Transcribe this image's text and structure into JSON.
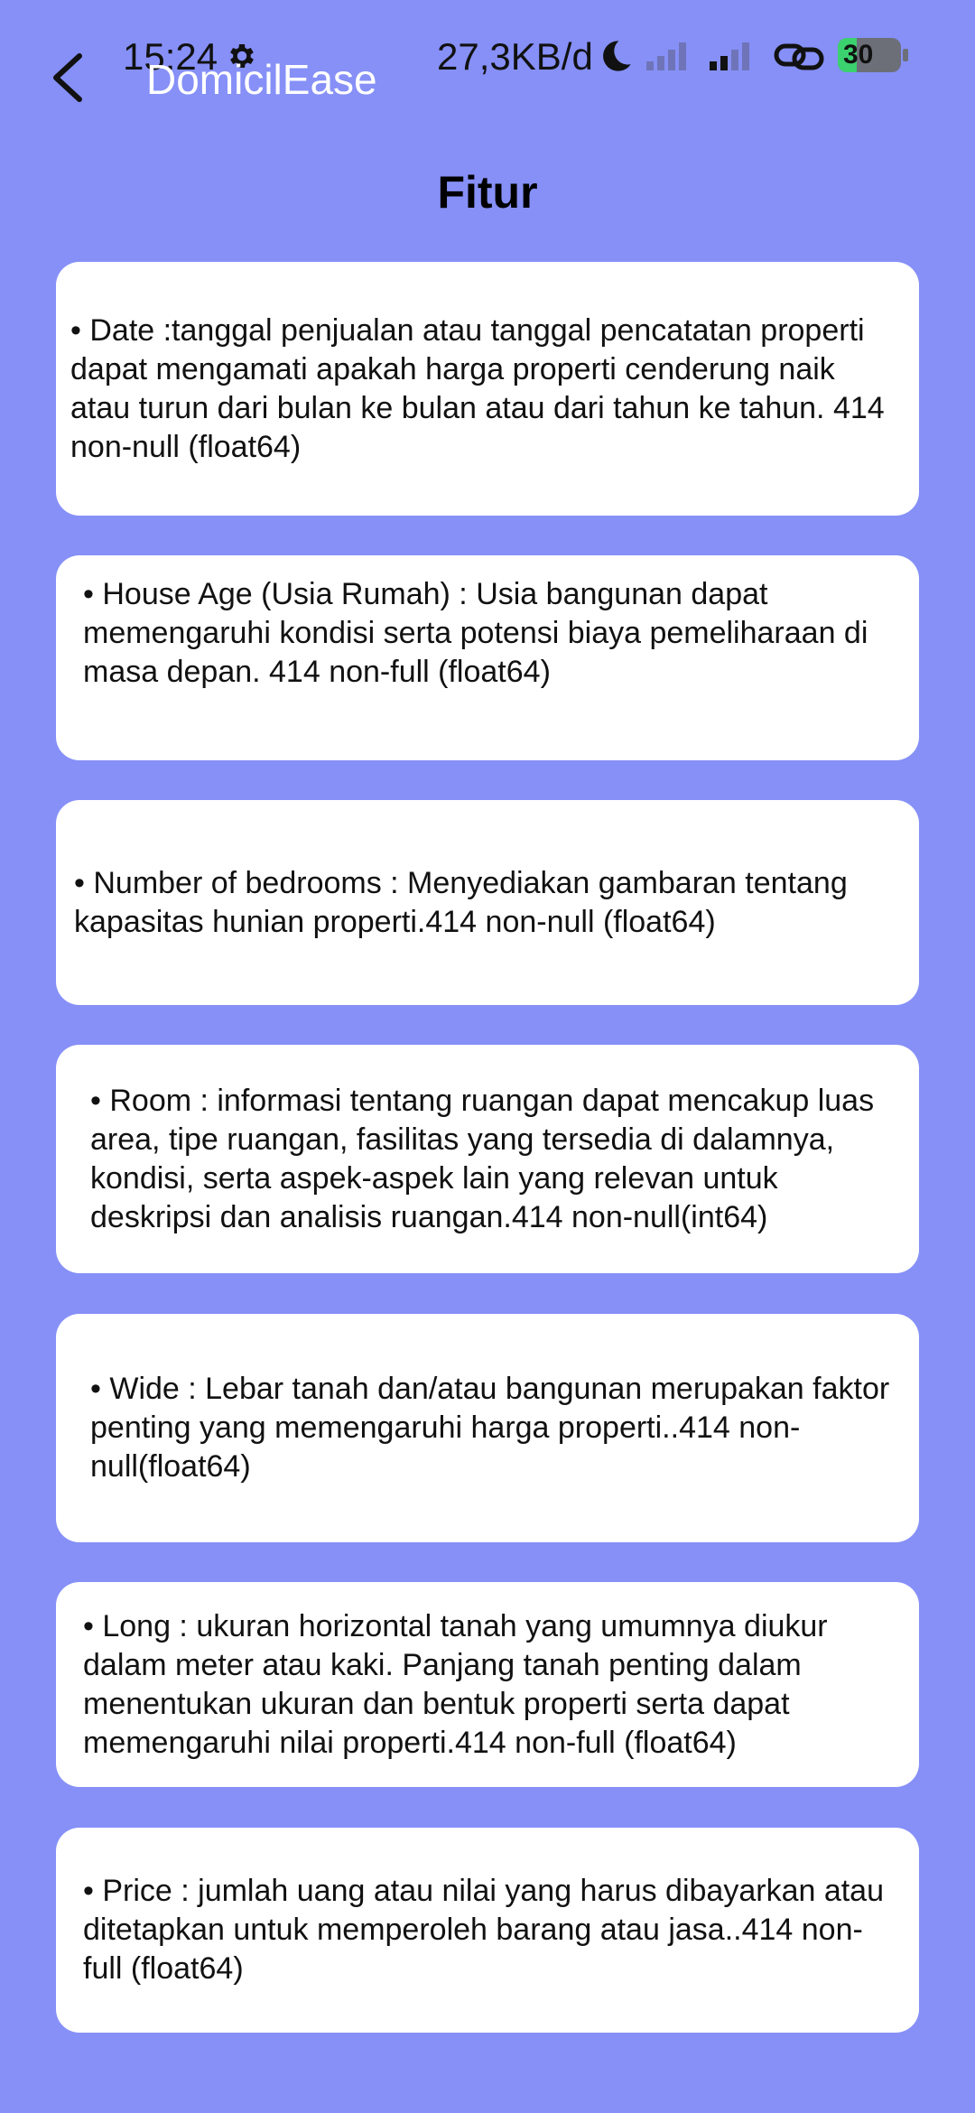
{
  "status_bar": {
    "time": "15:24",
    "network_speed": "27,3KB/d",
    "battery_level": "30",
    "battery_fraction": 0.3,
    "icons": [
      "gear-icon",
      "moon-icon",
      "signal-icon",
      "signal-icon",
      "link-icon",
      "battery-icon"
    ]
  },
  "app_bar": {
    "title": "DomicilEase",
    "back_icon": "back-arrow-icon"
  },
  "page": {
    "title": "Fitur"
  },
  "features": [
    {
      "text": "• Date :tanggal penjualan atau tanggal pencatatan properti dapat mengamati apakah harga properti cenderung naik atau turun dari bulan ke bulan atau dari tahun ke tahun. 414 non-null (float64)"
    },
    {
      "text": "• House Age (Usia Rumah) : Usia bangunan dapat memengaruhi kondisi serta potensi biaya pemeliharaan di masa depan. 414 non-full (float64)"
    },
    {
      "text": "• Number of bedrooms : Menyediakan gambaran tentang kapasitas hunian properti.414 non-null (float64)"
    },
    {
      "text": "• Room : informasi tentang ruangan dapat mencakup luas area, tipe ruangan, fasilitas yang tersedia di dalamnya, kondisi, serta aspek-aspek lain yang relevan untuk deskripsi dan analisis ruangan.414 non-null(int64)"
    },
    {
      "text": "• Wide : Lebar tanah dan/atau bangunan merupakan faktor penting yang memengaruhi harga properti..414 non-null(float64)"
    },
    {
      "text": "• Long : ukuran horizontal tanah yang umumnya diukur dalam meter atau kaki. Panjang tanah penting dalam menentukan ukuran dan bentuk properti serta dapat memengaruhi nilai properti.414 non-full (float64)"
    },
    {
      "text": "• Price : jumlah uang atau nilai yang harus dibayarkan atau ditetapkan untuk memperoleh barang atau jasa..414 non-full (float64)"
    }
  ],
  "colors": {
    "background": "#8690f7",
    "card": "#ffffff",
    "title_text": "#000000",
    "app_title_text": "#ffffff",
    "battery_fill": "#3bd16f"
  }
}
